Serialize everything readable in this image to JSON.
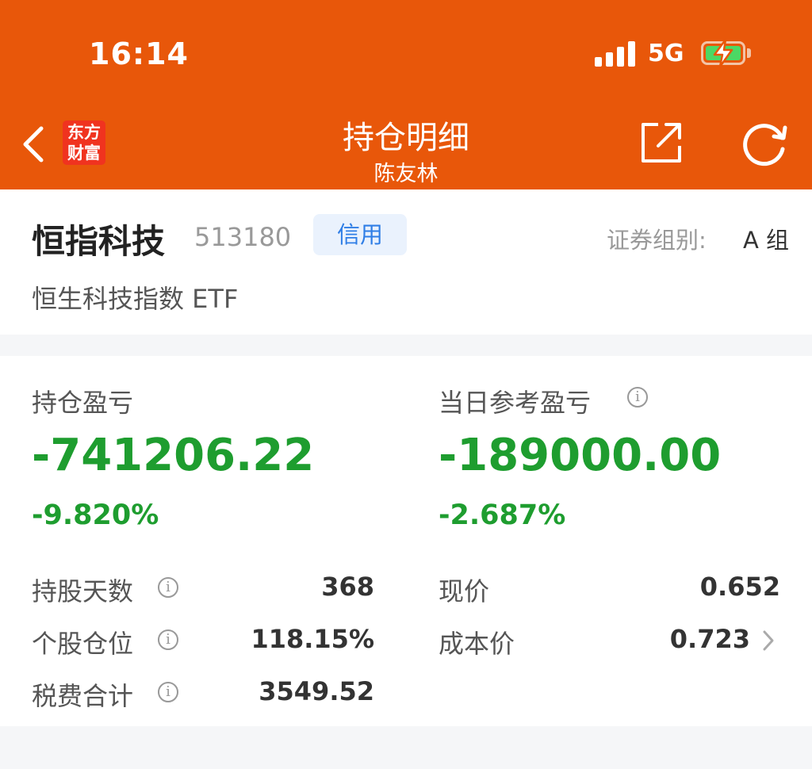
{
  "status_bar": {
    "time": "16:14",
    "network": "5G"
  },
  "header": {
    "logo_line1": "东方",
    "logo_line2": "财富",
    "title": "持仓明细",
    "subtitle": "陈友林"
  },
  "stock": {
    "name": "恒指科技",
    "code": "513180",
    "tag": "信用",
    "group_label": "证券组别:",
    "group_value": "A 组",
    "full_name": "恒生科技指数 ETF"
  },
  "pnl": {
    "position_label": "持仓盈亏",
    "position_value": "-741206.22",
    "position_pct": "-9.820%",
    "daily_label": "当日参考盈亏",
    "daily_value": "-189000.00",
    "daily_pct": "-2.687%"
  },
  "details": {
    "hold_days_label": "持股天数",
    "hold_days_value": "368",
    "position_ratio_label": "个股仓位",
    "position_ratio_value": "118.15%",
    "tax_label": "税费合计",
    "tax_value": "3549.52",
    "price_label": "现价",
    "price_value": "0.652",
    "cost_label": "成本价",
    "cost_value": "0.723"
  },
  "colors": {
    "header_bg": "#e8570a",
    "loss_green": "#1e9d2f",
    "tag_blue": "#2f7ee6",
    "logo_red": "#f0331f"
  },
  "icons": {
    "back": "chevron-left-icon",
    "share": "share-icon",
    "refresh": "refresh-icon",
    "info": "info-icon",
    "arrow": "chevron-right-icon"
  }
}
